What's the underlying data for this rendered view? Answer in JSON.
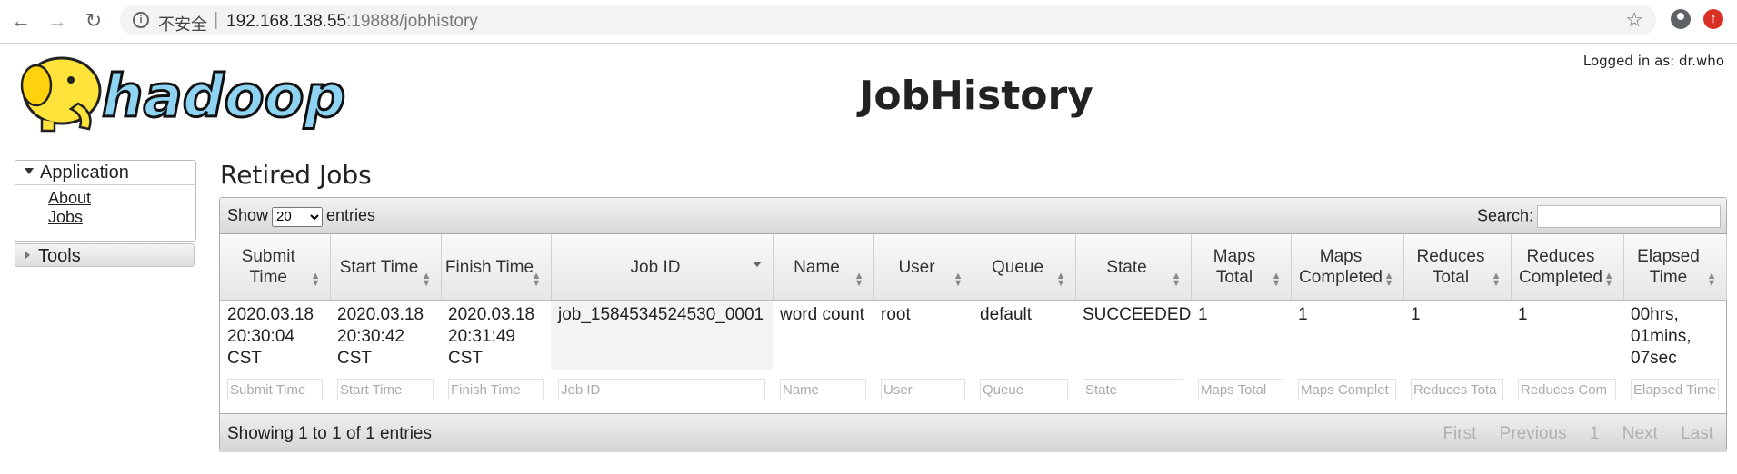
{
  "browser": {
    "insecure_label": "不安全",
    "separator": "|",
    "url_host": "192.168.138.55",
    "url_rest": ":19888/jobhistory"
  },
  "header": {
    "logged_in": "Logged in as: dr.who",
    "title": "JobHistory",
    "logo_text": "hadoop"
  },
  "sidebar": {
    "application_label": "Application",
    "links": [
      "About",
      "Jobs"
    ],
    "tools_label": "Tools"
  },
  "main": {
    "section_title": "Retired Jobs",
    "show_prefix": "Show",
    "show_value": "20",
    "show_suffix": "entries",
    "search_label": "Search:",
    "columns": [
      "Submit Time",
      "Start Time",
      "Finish Time",
      "Job ID",
      "Name",
      "User",
      "Queue",
      "State",
      "Maps Total",
      "Maps Completed",
      "Reduces Total",
      "Reduces Completed",
      "Elapsed Time"
    ],
    "rows": [
      {
        "submit_time": "2020.03.18 20:30:04 CST",
        "start_time": "2020.03.18 20:30:42 CST",
        "finish_time": "2020.03.18 20:31:49 CST",
        "job_id": "job_1584534524530_0001",
        "name": "word count",
        "user": "root",
        "queue": "default",
        "state": "SUCCEEDED",
        "maps_total": "1",
        "maps_completed": "1",
        "reduces_total": "1",
        "reduces_completed": "1",
        "elapsed_time": "00hrs, 01mins, 07sec"
      }
    ],
    "filters": [
      "Submit Time",
      "Start Time",
      "Finish Time",
      "Job ID",
      "Name",
      "User",
      "Queue",
      "State",
      "Maps Total",
      "Maps Complet",
      "Reduces Tota",
      "Reduces Com",
      "Elapsed Time"
    ],
    "info": "Showing 1 to 1 of 1 entries",
    "pager": [
      "First",
      "Previous",
      "1",
      "Next",
      "Last"
    ]
  },
  "colors": {
    "header_gradient_top": "#f2f2f2",
    "header_gradient_bottom": "#d8d8d8",
    "update_badge": "#d93025"
  }
}
